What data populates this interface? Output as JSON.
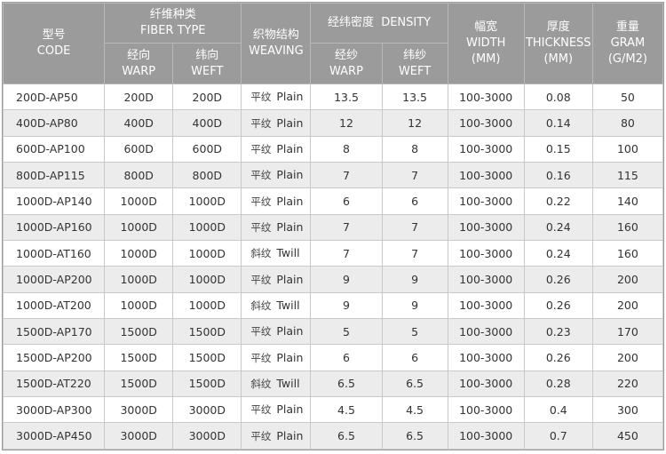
{
  "headers": {
    "code": [
      "型号",
      "CODE"
    ],
    "fiber_type": [
      "纤维种类",
      "FIBER TYPE"
    ],
    "warp": [
      "经向",
      "WARP"
    ],
    "weft": [
      "纬向",
      "WEFT"
    ],
    "weaving": [
      "织物结构",
      "WEAVING"
    ],
    "density": "经纬密度  DENSITY",
    "density_warp": [
      "经纱",
      "WARP"
    ],
    "density_weft": [
      "纬纱",
      "WEFT"
    ],
    "width": [
      "幅宽",
      "WIDTH",
      "(MM)"
    ],
    "thickness": [
      "厚度",
      "THICKNESS",
      "(MM)"
    ],
    "gram": [
      "重量",
      "GRAM",
      "(G/M2)"
    ]
  },
  "rows": [
    {
      "code": "200D-AP50",
      "warp": "200D",
      "weft": "200D",
      "weave_zh": "平纹",
      "weave_en": "Plain",
      "d_warp": "13.5",
      "d_weft": "13.5",
      "width": "100-3000",
      "thickness": "0.08",
      "gram": "50"
    },
    {
      "code": "400D-AP80",
      "warp": "400D",
      "weft": "400D",
      "weave_zh": "平纹",
      "weave_en": "Plain",
      "d_warp": "12",
      "d_weft": "12",
      "width": "100-3000",
      "thickness": "0.14",
      "gram": "80"
    },
    {
      "code": "600D-AP100",
      "warp": "600D",
      "weft": "600D",
      "weave_zh": "平纹",
      "weave_en": "Plain",
      "d_warp": "8",
      "d_weft": "8",
      "width": "100-3000",
      "thickness": "0.15",
      "gram": "100"
    },
    {
      "code": "800D-AP115",
      "warp": "800D",
      "weft": "800D",
      "weave_zh": "平纹",
      "weave_en": "Plain",
      "d_warp": "7",
      "d_weft": "7",
      "width": "100-3000",
      "thickness": "0.16",
      "gram": "115"
    },
    {
      "code": "1000D-AP140",
      "warp": "1000D",
      "weft": "1000D",
      "weave_zh": "平纹",
      "weave_en": "Plain",
      "d_warp": "6",
      "d_weft": "6",
      "width": "100-3000",
      "thickness": "0.22",
      "gram": "140"
    },
    {
      "code": "1000D-AP160",
      "warp": "1000D",
      "weft": "1000D",
      "weave_zh": "平纹",
      "weave_en": "Plain",
      "d_warp": "7",
      "d_weft": "7",
      "width": "100-3000",
      "thickness": "0.24",
      "gram": "160"
    },
    {
      "code": "1000D-AT160",
      "warp": "1000D",
      "weft": "1000D",
      "weave_zh": "斜纹",
      "weave_en": "Twill",
      "d_warp": "7",
      "d_weft": "7",
      "width": "100-3000",
      "thickness": "0.24",
      "gram": "160"
    },
    {
      "code": "1000D-AP200",
      "warp": "1000D",
      "weft": "1000D",
      "weave_zh": "平纹",
      "weave_en": "Plain",
      "d_warp": "9",
      "d_weft": "9",
      "width": "100-3000",
      "thickness": "0.26",
      "gram": "200"
    },
    {
      "code": "1000D-AT200",
      "warp": "1000D",
      "weft": "1000D",
      "weave_zh": "斜纹",
      "weave_en": "Twill",
      "d_warp": "9",
      "d_weft": "9",
      "width": "100-3000",
      "thickness": "0.26",
      "gram": "200"
    },
    {
      "code": "1500D-AP170",
      "warp": "1500D",
      "weft": "1500D",
      "weave_zh": "平纹",
      "weave_en": "Plain",
      "d_warp": "5",
      "d_weft": "5",
      "width": "100-3000",
      "thickness": "0.23",
      "gram": "170"
    },
    {
      "code": "1500D-AP200",
      "warp": "1500D",
      "weft": "1500D",
      "weave_zh": "平纹",
      "weave_en": "Plain",
      "d_warp": "6",
      "d_weft": "6",
      "width": "100-3000",
      "thickness": "0.26",
      "gram": "200"
    },
    {
      "code": "1500D-AT220",
      "warp": "1500D",
      "weft": "1500D",
      "weave_zh": "斜纹",
      "weave_en": "Twill",
      "d_warp": "6.5",
      "d_weft": "6.5",
      "width": "100-3000",
      "thickness": "0.28",
      "gram": "220"
    },
    {
      "code": "3000D-AP300",
      "warp": "3000D",
      "weft": "3000D",
      "weave_zh": "平纹",
      "weave_en": "Plain",
      "d_warp": "4.5",
      "d_weft": "4.5",
      "width": "100-3000",
      "thickness": "0.4",
      "gram": "300"
    },
    {
      "code": "3000D-AP450",
      "warp": "3000D",
      "weft": "3000D",
      "weave_zh": "平纹",
      "weave_en": "Plain",
      "d_warp": "6.5",
      "d_weft": "6.5",
      "width": "100-3000",
      "thickness": "0.7",
      "gram": "450"
    }
  ]
}
